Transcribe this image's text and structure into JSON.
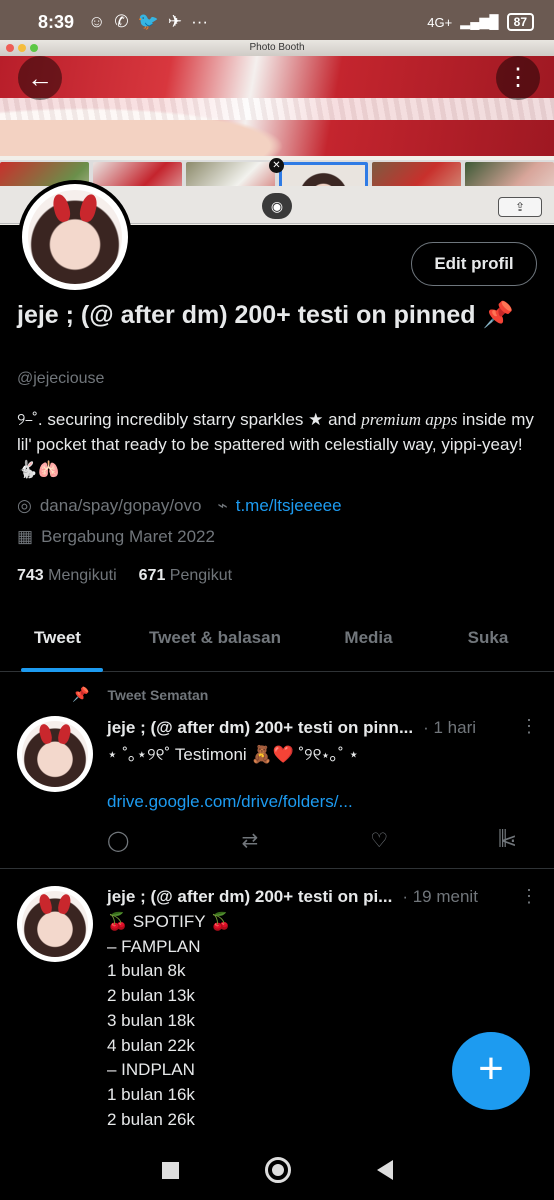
{
  "status": {
    "time": "8:39",
    "network": "4G+",
    "battery": "87"
  },
  "banner": {
    "window_title": "Photo Booth"
  },
  "profile": {
    "edit_label": "Edit profil",
    "name": "jeje ; (@ after dm) 200+ testi on pinned 📌",
    "handle": "@jejeciouse",
    "bio_prefix": "୨⎯˚. securing incredibly starry sparkles ★ and ",
    "bio_italic": "premium apps",
    "bio_suffix": " inside my lil' pocket that ready to be spattered with celestially way, yippi-yeay! 🐇🫁",
    "payment": "dana/spay/gopay/ovo",
    "link": "t.me/ltsjeeeee",
    "joined": "Bergabung Maret 2022",
    "following_count": "743",
    "following_label": "Mengikuti",
    "followers_count": "671",
    "followers_label": "Pengikut"
  },
  "tabs": [
    {
      "label": "Tweet"
    },
    {
      "label": "Tweet & balasan"
    },
    {
      "label": "Media"
    },
    {
      "label": "Suka"
    }
  ],
  "pinned_label": "Tweet Sematan",
  "tweets": [
    {
      "name": "jeje ; (@ after dm) 200+ testi on pinn...",
      "time": "· 1 hari",
      "text": "⋆ ˚｡⋆୨୧˚ Testimoni 🧸❤️ ˚୨୧⋆｡˚ ⋆",
      "link": "drive.google.com/drive/folders/..."
    },
    {
      "name": "jeje ; (@ after dm) 200+ testi on pi...",
      "time": "· 19 menit",
      "lines": [
        "🍒 SPOTIFY 🍒",
        "– FAMPLAN",
        "1 bulan 8k",
        "2 bulan 13k",
        "3 bulan 18k",
        "4 bulan 22k",
        "– INDPLAN",
        "1 bulan 16k",
        "2 bulan 26k"
      ]
    }
  ],
  "icons": {
    "back": "arrow-left-icon",
    "more": "more-vertical-icon",
    "camera": "camera-icon",
    "location": "location-icon",
    "link": "link-icon",
    "calendar": "calendar-icon",
    "pin": "pin-icon",
    "reply": "reply-icon",
    "retweet": "retweet-icon",
    "like": "heart-icon",
    "share": "share-icon",
    "analytics": "analytics-icon",
    "compose": "plus-icon"
  },
  "colors": {
    "accent": "#1d9bf0",
    "background": "#000000",
    "muted": "#71767b"
  }
}
